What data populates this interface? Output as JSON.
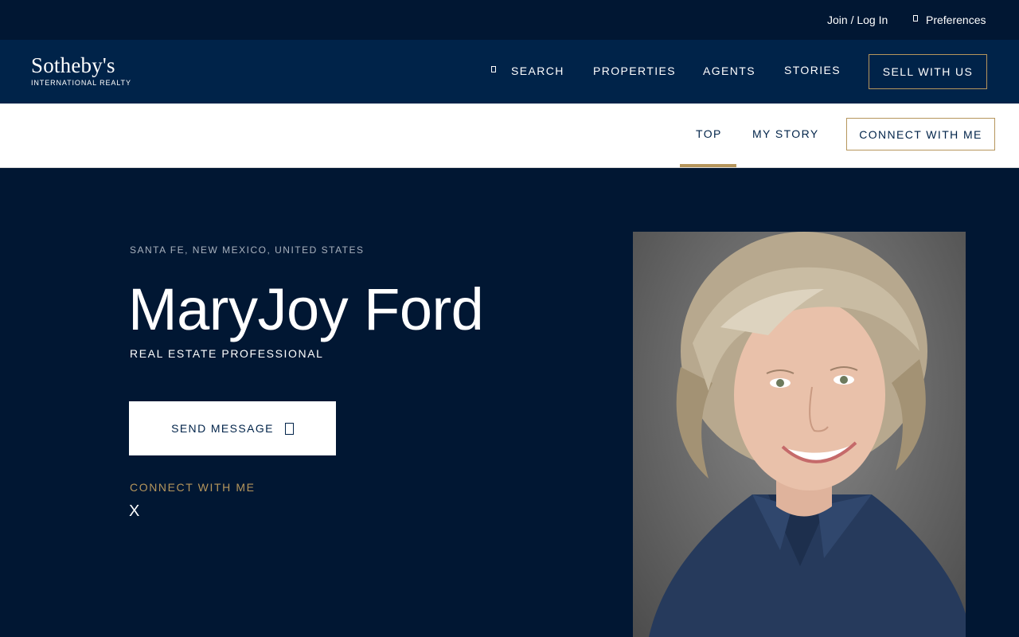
{
  "utility": {
    "join_label": "Join / Log In",
    "preferences_label": "Preferences"
  },
  "logo": {
    "wordmark": "Sotheby's",
    "subline": "INTERNATIONAL REALTY"
  },
  "nav": {
    "search": "SEARCH",
    "properties": "PROPERTIES",
    "agents": "AGENTS",
    "stories": "STORIES",
    "sell": "SELL WITH US"
  },
  "subnav": {
    "top": "TOP",
    "my_story": "MY STORY",
    "connect": "CONNECT WITH ME"
  },
  "agent": {
    "location": "SANTA FE, NEW MEXICO, UNITED STATES",
    "name": "MaryJoy Ford",
    "title": "REAL ESTATE PROFESSIONAL",
    "send_message": "SEND MESSAGE",
    "connect_label": "CONNECT WITH ME",
    "social_x": "X"
  },
  "colors": {
    "navy": "#002349",
    "dark_navy": "#011733",
    "gold": "#b6965c"
  }
}
